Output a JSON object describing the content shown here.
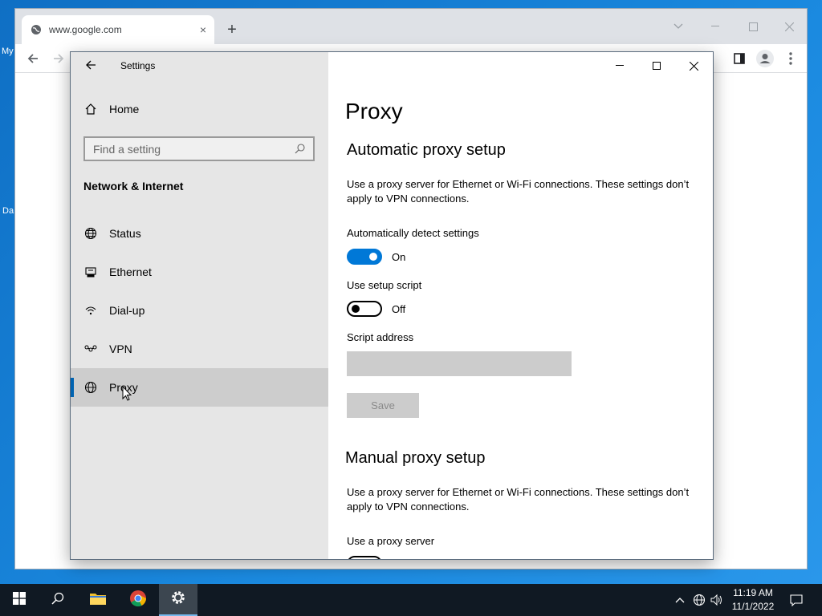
{
  "desktop": {
    "labels": [
      "My",
      "Da"
    ]
  },
  "chrome": {
    "tab_title": "www.google.com",
    "new_tab": "+",
    "close_tab": "×"
  },
  "settings": {
    "window_title": "Settings",
    "home_label": "Home",
    "search_placeholder": "Find a setting",
    "section_title": "Network & Internet",
    "nav_items": [
      {
        "label": "Status",
        "icon": "globe-status-icon"
      },
      {
        "label": "Ethernet",
        "icon": "ethernet-icon"
      },
      {
        "label": "Dial-up",
        "icon": "dialup-icon"
      },
      {
        "label": "VPN",
        "icon": "vpn-icon"
      },
      {
        "label": "Proxy",
        "icon": "globe-icon",
        "selected": true
      }
    ],
    "page_title": "Proxy",
    "auto_heading": "Automatic proxy setup",
    "auto_desc": "Use a proxy server for Ethernet or Wi-Fi connections. These settings don’t apply to VPN connections.",
    "auto_detect_label": "Automatically detect settings",
    "auto_detect_state": "On",
    "auto_detect_on": true,
    "setup_script_label": "Use setup script",
    "setup_script_state": "Off",
    "setup_script_on": false,
    "script_address_label": "Script address",
    "script_address_value": "",
    "save_label": "Save",
    "manual_heading": "Manual proxy setup",
    "manual_desc": "Use a proxy server for Ethernet or Wi-Fi connections. These settings don’t apply to VPN connections.",
    "use_proxy_label": "Use a proxy server"
  },
  "taskbar": {
    "time": "11:19 AM",
    "date": "11/1/2022"
  },
  "colors": {
    "accent": "#0078d7",
    "sidebar_bg": "#e6e6e6",
    "selected_bg": "#cdcdcd"
  }
}
